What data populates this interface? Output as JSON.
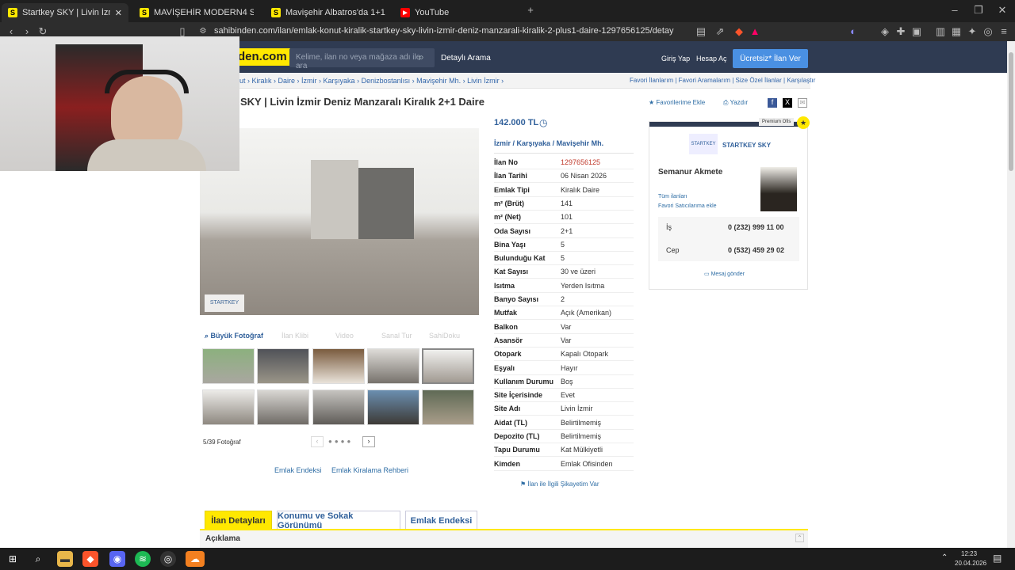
{
  "browser": {
    "tabs": [
      {
        "title": "Startkey SKY | Livin İzmir Deniz M",
        "active": true
      },
      {
        "title": "MAVİŞEHİR MODERN4 SİTESİNDE 2+"
      },
      {
        "title": "Mavişehir Albatros'da 1+1 Deniz Ma"
      },
      {
        "title": "YouTube"
      }
    ],
    "url": "sahibinden.com/ilan/emlak-konut-kiralik-startkey-sky-livin-izmir-deniz-manzarali-kiralik-2-plus1-daire-1297656125/detay"
  },
  "header": {
    "logo": "den.com",
    "search_placeholder": "Kelime, ilan no veya mağaza adı ile ara",
    "detailed_search": "Detaylı Arama",
    "login": "Giriş Yap",
    "register": "Hesap Aç",
    "post_ad": "Ücretsiz* İlan Ver"
  },
  "breadcrumb": [
    "ut",
    "Kiralık",
    "Daire",
    "İzmir",
    "Karşıyaka",
    "Denizbostanlısı",
    "Mavişehir Mh.",
    "Livin İzmir"
  ],
  "crumb_links": [
    "Favori İlanlarım",
    "Favori Aramalarım",
    "Size Özel İlanlar",
    "Karşılaştır"
  ],
  "listing": {
    "title": "SKY | Livin İzmir Deniz Manzaralı Kiralık 2+1 Daire",
    "add_favorite": "Favorilerime Ekle",
    "print": "Yazdır",
    "price": "142.000 TL",
    "location": [
      "İzmir",
      "Karşıyaka",
      "Mavişehir Mh."
    ],
    "photo_counter": "5/39 Fotoğraf",
    "big_photo": "Büyük Fotoğraf",
    "media_tabs": [
      "İlan Klibi",
      "Video",
      "Sanal Tur",
      "SahiDoku"
    ],
    "links": [
      "Emlak Endeksi",
      "Emlak Kiralama Rehberi"
    ],
    "complaint": "İlan ile İlgili Şikayetim Var"
  },
  "attributes": [
    {
      "k": "İlan No",
      "v": "1297656125",
      "red": true
    },
    {
      "k": "İlan Tarihi",
      "v": "06 Nisan 2026"
    },
    {
      "k": "Emlak Tipi",
      "v": "Kiralık Daire"
    },
    {
      "k": "m² (Brüt)",
      "v": "141"
    },
    {
      "k": "m² (Net)",
      "v": "101"
    },
    {
      "k": "Oda Sayısı",
      "v": "2+1"
    },
    {
      "k": "Bina Yaşı",
      "v": "5"
    },
    {
      "k": "Bulunduğu Kat",
      "v": "5"
    },
    {
      "k": "Kat Sayısı",
      "v": "30 ve üzeri"
    },
    {
      "k": "Isıtma",
      "v": "Yerden Isıtma"
    },
    {
      "k": "Banyo Sayısı",
      "v": "2"
    },
    {
      "k": "Mutfak",
      "v": "Açık (Amerikan)"
    },
    {
      "k": "Balkon",
      "v": "Var"
    },
    {
      "k": "Asansör",
      "v": "Var"
    },
    {
      "k": "Otopark",
      "v": "Kapalı Otopark"
    },
    {
      "k": "Eşyalı",
      "v": "Hayır"
    },
    {
      "k": "Kullanım Durumu",
      "v": "Boş"
    },
    {
      "k": "Site İçerisinde",
      "v": "Evet"
    },
    {
      "k": "Site Adı",
      "v": "Livin İzmir"
    },
    {
      "k": "Aidat (TL)",
      "v": "Belirtilmemiş"
    },
    {
      "k": "Depozito (TL)",
      "v": "Belirtilmemiş"
    },
    {
      "k": "Tapu Durumu",
      "v": "Kat Mülkiyetli"
    },
    {
      "k": "Kimden",
      "v": "Emlak Ofisinden"
    }
  ],
  "seller": {
    "badge": "Premium Ofis",
    "office": "STARTKEY SKY",
    "name": "Semanur Akmete",
    "all_ads": "Tüm ilanları",
    "fav_seller": "Favori Satıcılarıma ekle",
    "phones": [
      {
        "label": "İş",
        "number": "0 (232) 999 11 00"
      },
      {
        "label": "Cep",
        "number": "0 (532) 459 29 02"
      }
    ],
    "message": "Mesaj gönder"
  },
  "bottom_tabs": [
    "İlan Detayları",
    "Konumu ve Sokak Görünümü",
    "Emlak Endeksi"
  ],
  "section_title": "Açıklama",
  "taskbar": {
    "time": "12:23",
    "date": "20.04.2026"
  },
  "colors": {
    "accent": "#ffe800",
    "header_bg": "#2f3b52",
    "link": "#2f6ea5",
    "post_btn": "#4a90e2"
  }
}
